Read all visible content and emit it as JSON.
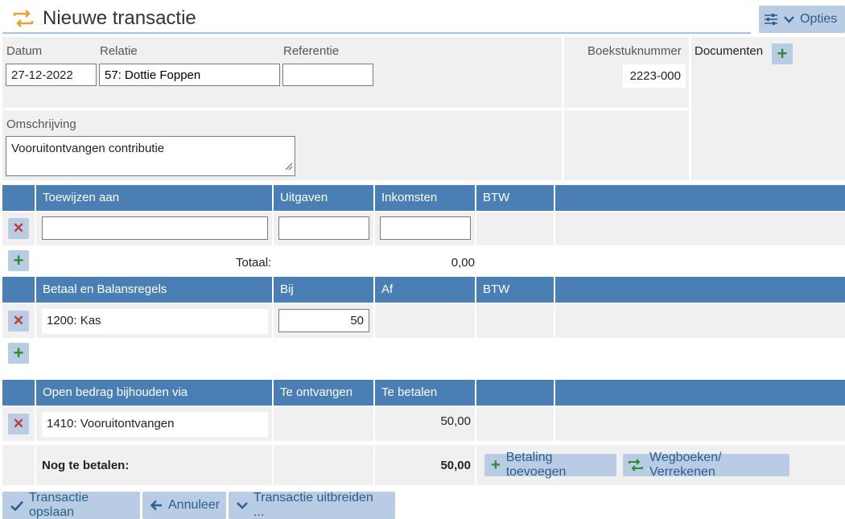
{
  "header": {
    "title": "Nieuwe transactie",
    "options_label": "Opties"
  },
  "form": {
    "datum_label": "Datum",
    "datum_value": "27-12-2022",
    "relatie_label": "Relatie",
    "relatie_value": "57: Dottie Foppen",
    "referentie_label": "Referentie",
    "referentie_value": "",
    "boekstuk_label": "Boekstuknummer",
    "boekstuk_value": "2223-000",
    "documenten_label": "Documenten",
    "omschrijving_label": "Omschrijving",
    "omschrijving_value": "Vooruitontvangen contributie"
  },
  "toewijzen": {
    "headers": [
      "Toewijzen aan",
      "Uitgaven",
      "Inkomsten",
      "BTW"
    ],
    "row": {
      "account": "",
      "uitgaven": "",
      "inkomsten": ""
    },
    "totaal_label": "Totaal:",
    "totaal_value": "0,00"
  },
  "betaal": {
    "headers": [
      "Betaal en Balansregels",
      "Bij",
      "Af",
      "BTW"
    ],
    "row": {
      "account": "1200: Kas",
      "bij": "50"
    }
  },
  "open": {
    "headers": [
      "Open bedrag bijhouden via",
      "Te ontvangen",
      "Te betalen"
    ],
    "row": {
      "account": "1410: Vooruitontvangen",
      "te_betalen": "50,00"
    },
    "nog_label": "Nog te betalen:",
    "nog_value": "50,00",
    "betaling_button": "Betaling toevoegen",
    "wegboeken_button": "Wegboeken/ Verrekenen"
  },
  "footer": {
    "save_label": "Transactie opslaan",
    "cancel_label": "Annuleer",
    "expand_label": "Transactie uitbreiden ..."
  },
  "colors": {
    "header_blue": "#4a7fb5",
    "button_bg": "#b8cde3",
    "accent_orange": "#f0a030"
  }
}
